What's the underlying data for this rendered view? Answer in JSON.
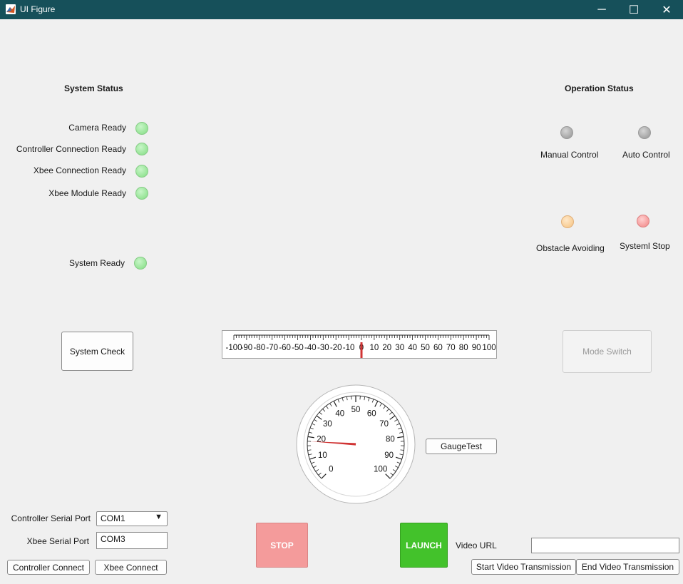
{
  "window": {
    "title": "UI Figure",
    "minimize_glyph": "─",
    "maximize_glyph": "☐",
    "close_glyph": "✕"
  },
  "system_status": {
    "header": "System Status",
    "items": [
      {
        "label": "Camera Ready",
        "lamp": "green"
      },
      {
        "label": "Controller Connection Ready",
        "lamp": "green"
      },
      {
        "label": "Xbee Connection Ready",
        "lamp": "green"
      },
      {
        "label": "Xbee Module Ready",
        "lamp": "green"
      },
      {
        "label": "System Ready",
        "lamp": "green"
      }
    ],
    "check_button": "System Check"
  },
  "operation_status": {
    "header": "Operation Status",
    "items": [
      {
        "label": "Manual Control",
        "lamp": "gray"
      },
      {
        "label": "Auto Control",
        "lamp": "gray"
      },
      {
        "label": "Obstacle Avoiding",
        "lamp": "orange"
      },
      {
        "label": "Systeml Stop",
        "lamp": "red"
      }
    ],
    "mode_switch_button": "Mode Switch"
  },
  "linear_gauge": {
    "min": -100,
    "max": 100,
    "value": 0,
    "tick_labels": [
      "-100",
      "-90",
      "-80",
      "-70",
      "-60",
      "-50",
      "-40",
      "-30",
      "-20",
      "-10",
      "0",
      "10",
      "20",
      "30",
      "40",
      "50",
      "60",
      "70",
      "80",
      "90",
      "100"
    ]
  },
  "circular_gauge": {
    "min": 0,
    "max": 100,
    "value": 18,
    "tick_labels": [
      "0",
      "10",
      "20",
      "30",
      "40",
      "50",
      "60",
      "70",
      "80",
      "90",
      "100"
    ]
  },
  "gauge_test_button": "GaugeTest",
  "stop_button": "STOP",
  "launch_button": "LAUNCH",
  "serial": {
    "controller_label": "Controller Serial Port",
    "controller_value": "COM1",
    "xbee_label": "Xbee Serial Port",
    "xbee_value": "COM3",
    "controller_connect": "Controller Connect",
    "xbee_connect": "Xbee Connect"
  },
  "video": {
    "url_label": "Video URL",
    "url_value": "",
    "start_button": "Start Video Transmission",
    "end_button": "End Video Transmission"
  },
  "colors": {
    "titlebar": "#16505a",
    "lamp_green": "#97e497",
    "lamp_gray": "#a6a6a6",
    "lamp_orange": "#f8cd95",
    "lamp_red": "#f59a9a",
    "stop": "#f49b9b",
    "launch": "#43c22b",
    "needle": "#d03434"
  }
}
